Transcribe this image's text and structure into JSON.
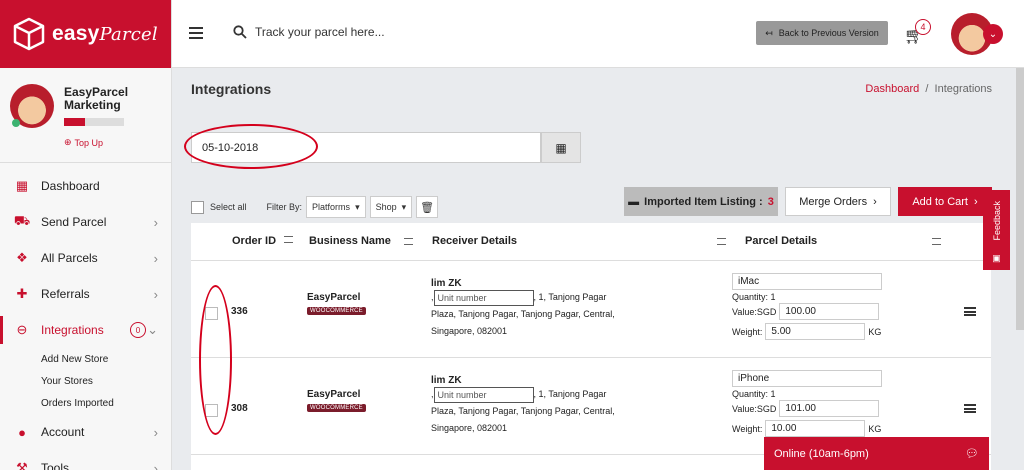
{
  "brand": {
    "name": "easy",
    "name_italic": "Parcel"
  },
  "profile": {
    "name": "EasyParcel Marketing",
    "topup": "Top Up"
  },
  "nav": [
    {
      "label": "Dashboard",
      "icon": "dashboard-icon"
    },
    {
      "label": "Send Parcel",
      "icon": "truck-icon"
    },
    {
      "label": "All Parcels",
      "icon": "parcels-icon"
    },
    {
      "label": "Referrals",
      "icon": "referrals-icon"
    },
    {
      "label": "Integrations",
      "icon": "link-icon",
      "badge": "0"
    },
    {
      "label": "Account",
      "icon": "user-icon"
    },
    {
      "label": "Tools",
      "icon": "tools-icon"
    }
  ],
  "subnav": [
    "Add New Store",
    "Your Stores",
    "Orders Imported"
  ],
  "topbar": {
    "search_placeholder": "Track your parcel here...",
    "back_label": "Back to Previous Version",
    "cart_count": "4"
  },
  "page": {
    "title": "Integrations",
    "breadcrumb_home": "Dashboard",
    "breadcrumb_current": "Integrations"
  },
  "date_value": "05-10-2018",
  "filters": {
    "select_all": "Select all",
    "filter_by": "Filter By:",
    "platforms": "Platforms",
    "shop": "Shop"
  },
  "actions": {
    "imported_label": "Imported Item Listing :",
    "imported_count": "3",
    "merge": "Merge Orders",
    "add_to_cart": "Add to Cart"
  },
  "feedback": "Feedback",
  "table": {
    "headers": [
      "Order ID",
      "Business Name",
      "Receiver Details",
      "Parcel Details"
    ],
    "rows": [
      {
        "order_id": "336",
        "business": "EasyParcel",
        "platform": "WOOCOMMERCE",
        "receiver": "lim ZK",
        "addr_prefix": ",",
        "unit_placeholder": "Unit number",
        "addr_rest": ", 1, Tanjong Pagar Plaza, Tanjong Pagar, Tanjong Pagar, Central, Singapore, 082001",
        "item": "iMac",
        "quantity": "Quantity: 1",
        "value_label": "Value:SGD",
        "value": "100.00",
        "weight_label": "Weight:",
        "weight": "5.00",
        "unit": "KG"
      },
      {
        "order_id": "308",
        "business": "EasyParcel",
        "platform": "WOOCOMMERCE",
        "receiver": "lim ZK",
        "addr_prefix": ",",
        "unit_placeholder": "Unit number",
        "addr_rest": ", 1, Tanjong Pagar Plaza, Tanjong Pagar, Tanjong Pagar, Central, Singapore, 082001",
        "item": "iPhone",
        "quantity": "Quantity: 1",
        "value_label": "Value:SGD",
        "value": "101.00",
        "weight_label": "Weight:",
        "weight": "10.00",
        "unit": "KG"
      }
    ]
  },
  "online": "Online (10am-6pm)"
}
